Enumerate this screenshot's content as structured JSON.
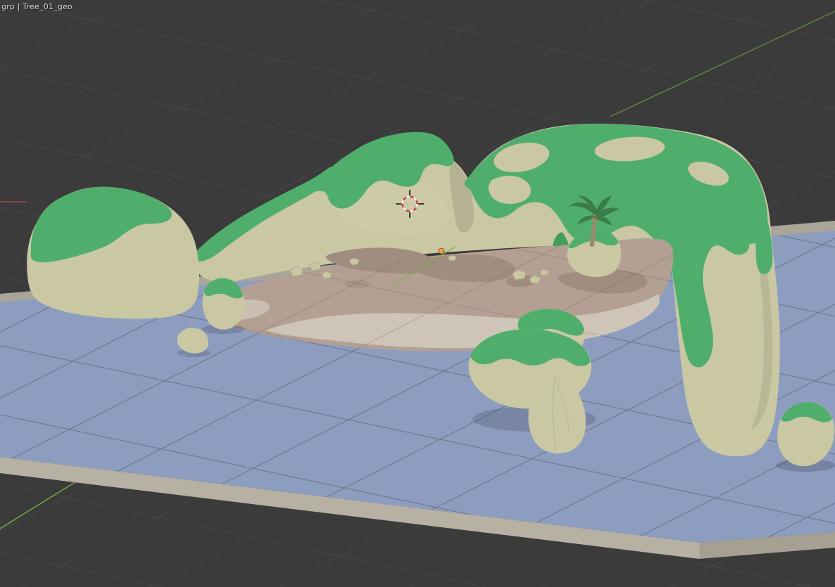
{
  "viewport": {
    "breadcrumb": "grp | Tree_01_geo",
    "background": "#3b3b3b",
    "grid_color": "#4a4a4a"
  },
  "axes": {
    "x_axis_color": "#b05252",
    "y_axis_color": "#79b43f"
  },
  "colors": {
    "water": "#8c9dc0",
    "plane_edge": "#b7b1a4",
    "plane_edge_dark": "#a6a093",
    "rock": "#c9c8a3",
    "rock_shade": "#b5b491",
    "rock_dark": "#a2a181",
    "grass": "#50ae6c",
    "grass_dark": "#419e5b",
    "sand": "#b3a093",
    "sand_light": "#cec4b7",
    "sand_dark": "#a08d7f",
    "palm_leaf": "#3b7c49",
    "palm_trunk": "#9a8a6b",
    "origin_dot": "#ec9e4d",
    "cursor_red": "#c83d3d",
    "cursor_white": "#efefef"
  }
}
